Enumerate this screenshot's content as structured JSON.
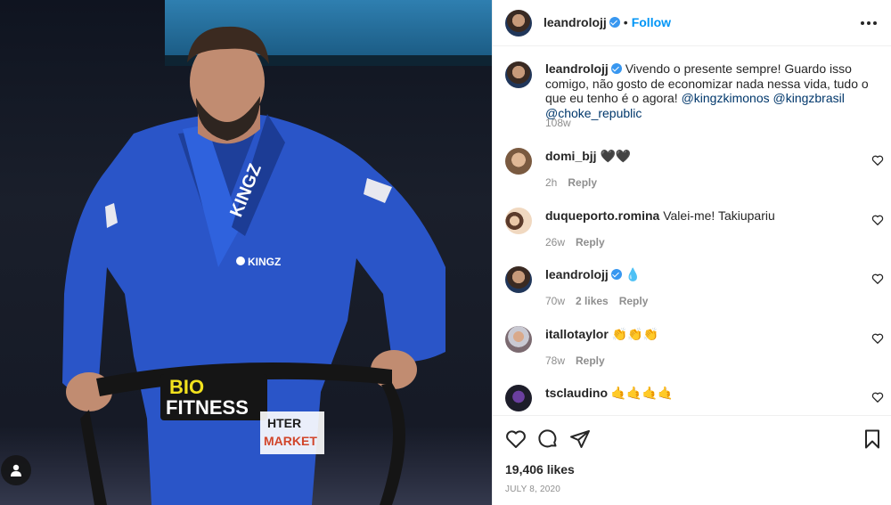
{
  "post": {
    "username": "leandrolojj",
    "follow_label": "Follow",
    "dot": "•",
    "caption": {
      "text": "Vivendo o presente sempre! Guardo isso comigo, não gosto de economizar nada nessa vida, tudo o que eu tenho é o agora!",
      "mentions": [
        "@kingzkimonos",
        "@kingzbrasil",
        "@choke_republic"
      ]
    },
    "caption_time": "108w",
    "photo_text": {
      "jacket_brand": "KINGZ",
      "chest_brand": "KINGZ",
      "belt_line1": "BIO",
      "belt_line2": "FITNESS",
      "patch_line1": "HTER",
      "patch_line2": "MARKET"
    }
  },
  "comments": [
    {
      "username": "domi_bjj",
      "text": "🖤🖤",
      "time": "2h",
      "likes": "",
      "reply": "Reply",
      "verified": false
    },
    {
      "username": "duqueporto.romina",
      "text": "Valei-me! Takiupariu",
      "time": "26w",
      "likes": "",
      "reply": "Reply",
      "verified": false
    },
    {
      "username": "leandrolojj",
      "text": "💧",
      "time": "70w",
      "likes": "2 likes",
      "reply": "Reply",
      "verified": true
    },
    {
      "username": "itallotaylor",
      "text": "👏👏👏",
      "time": "78w",
      "likes": "",
      "reply": "Reply",
      "verified": false
    },
    {
      "username": "tsclaudino",
      "text": "🤙🤙🤙🤙",
      "time": "",
      "likes": "",
      "reply": "",
      "verified": false
    }
  ],
  "footer": {
    "likes": "19,406 likes",
    "date": "July 8, 2020"
  },
  "icons": {
    "header_more": "more-options-icon",
    "like": "heart-icon",
    "comment": "comment-bubble-icon",
    "share": "paper-plane-icon",
    "save": "bookmark-icon"
  },
  "colors": {
    "link_blue": "#0095f6",
    "mention_blue": "#00376b",
    "muted": "#8e8e8e",
    "verified": "#3897f0",
    "gi_blue": "#2a55c8"
  }
}
